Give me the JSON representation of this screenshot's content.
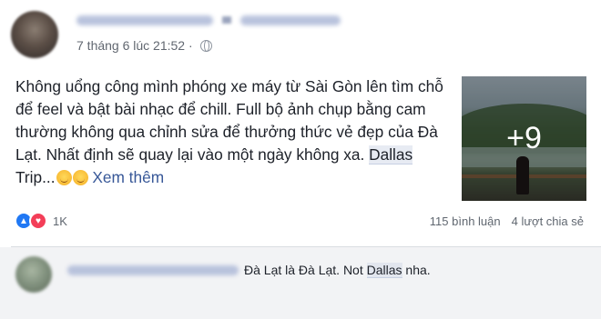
{
  "post": {
    "timestamp": "7 tháng 6 lúc 21:52 ·",
    "privacy_icon": "globe-icon",
    "text_before": "Không uổng công mình phóng xe máy từ Sài Gòn lên tìm chỗ để feel và bật bài nhạc để chill. Full bộ ảnh chụp bằng cam thường không qua chỉnh sửa để thưởng thức vẻ đẹp của Đà Lạt. Nhất định sẽ quay lại vào một ngày không xa. ",
    "highlight": "Dallas",
    "text_after": " Trip...",
    "see_more": "Xem thêm",
    "photo_more": "+9"
  },
  "reactions": {
    "count": "1K",
    "icons": [
      "like-icon",
      "love-icon"
    ],
    "like_color": "#2078f4",
    "love_color": "#f33e58"
  },
  "stats": {
    "comments": "115 bình luận",
    "shares": "4 lượt chia sẻ"
  },
  "comment": {
    "text_before": "Đà Lạt là Đà Lạt. Not ",
    "highlight": "Dallas",
    "text_after": " nha."
  }
}
